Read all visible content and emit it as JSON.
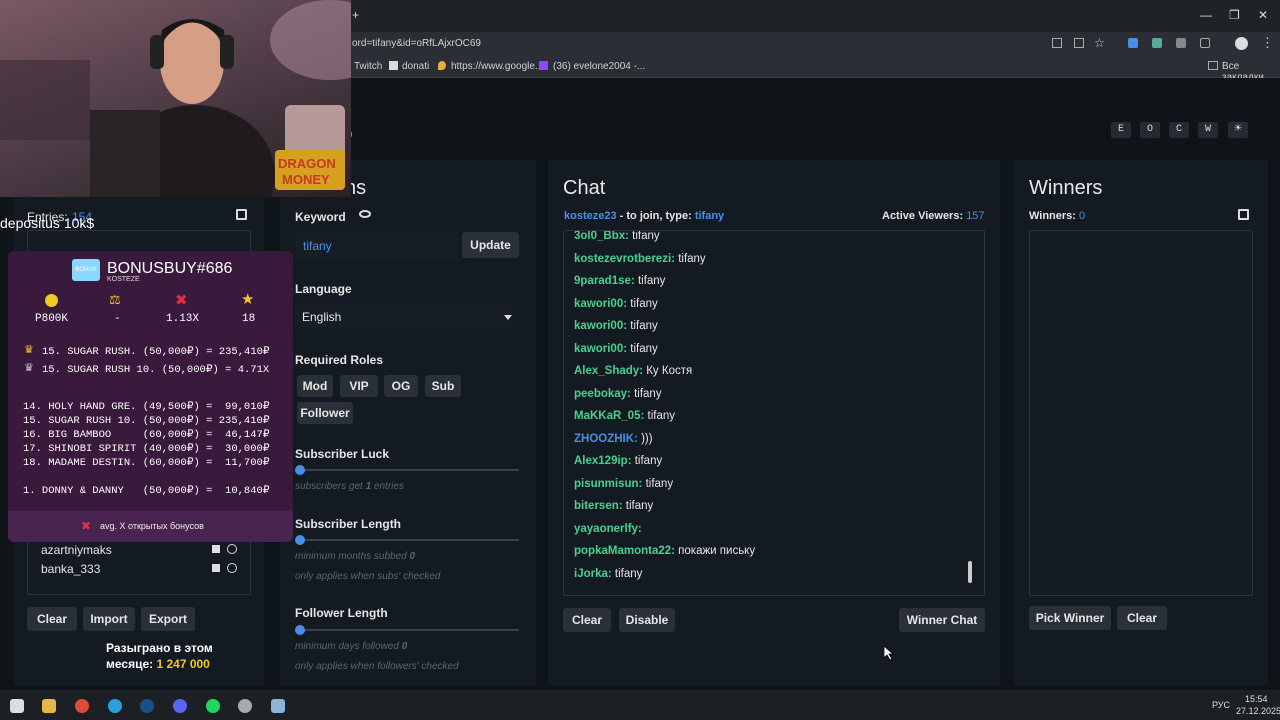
{
  "browser": {
    "url_fragment": "ord=tifany&id=oRfLAjxrOC69",
    "bookmarks": [
      "Twitch",
      "donati",
      "https://www.google...",
      "(36) evelone2004 -...",
      "Все закладки"
    ],
    "win_controls": [
      "—",
      "❐",
      "✕"
    ],
    "new_tab": "+"
  },
  "header": {
    "partial_title": "9",
    "theme_buttons": [
      "E",
      "O",
      "C",
      "W",
      "☀"
    ]
  },
  "overlay": {
    "deposit_text": "depositus 10k$",
    "footer_line1": "Разыграно в этом",
    "footer_line2_label": "месяце:",
    "footer_line2_value": "1 247 000",
    "bonus": {
      "title": "BONUSBUY#686",
      "subtitle": "KOSTEZE",
      "icon_label": "BONUS",
      "stats": [
        {
          "icon": "coin-icon",
          "value": "P800K"
        },
        {
          "icon": "scale-icon",
          "value": "-"
        },
        {
          "icon": "cross-icon",
          "value": "1.13X"
        },
        {
          "icon": "star-icon",
          "value": "18"
        }
      ],
      "top_lines": [
        "15. SUGAR RUSH. (50,000₽) = 235,410₽",
        "15. SUGAR RUSH 10. (50,000₽) = 4.71X"
      ],
      "list_lines": [
        "14. HOLY HAND GRE. (49,500₽) =  99,010₽",
        "15. SUGAR RUSH 10. (50,000₽) = 235,410₽",
        "16. BIG BAMBOO     (60,000₽) =  46,147₽",
        "17. SHINOBI SPIRIT (40,000₽) =  30,000₽",
        "18. MADAME DESTIN. (60,000₽) =  11,700₽"
      ],
      "bottom_line": "1. DONNY & DANNY   (50,000₽) =  10,840₽",
      "footer": "avg. X открытых бонусов"
    }
  },
  "entries": {
    "label": "Entries:",
    "count": "154",
    "users": [
      "azartniymaks",
      "banka_333"
    ],
    "buttons": [
      "Clear",
      "Import",
      "Export"
    ]
  },
  "options": {
    "partial_heading": "ns",
    "keyword_label": "Keyword",
    "keyword_value": "tifany",
    "update_btn": "Update",
    "language_label": "Language",
    "language_value": "English",
    "roles_label": "Required Roles",
    "roles": [
      "Mod",
      "VIP",
      "OG",
      "Sub",
      "Follower"
    ],
    "sub_luck_label": "Subscriber Luck",
    "sub_luck_hint_pre": "subscribers get",
    "sub_luck_hint_num": "1",
    "sub_luck_hint_post": "entries",
    "sub_length_label": "Subscriber Length",
    "sub_length_hint_pre": "minimum months subbed",
    "sub_length_hint_num": "0",
    "sub_length_hint2": "only applies when subs' checked",
    "follow_length_label": "Follower Length",
    "follow_length_hint_pre": "minimum days followed",
    "follow_length_hint_num": "0",
    "follow_length_hint2": "only applies when followers' checked"
  },
  "chat": {
    "heading": "Chat",
    "join_user": "kosteze23",
    "join_text": "- to join, type:",
    "join_keyword": "tifany",
    "viewers_label": "Active Viewers:",
    "viewers_count": "157",
    "messages": [
      {
        "user": "3ol0_Bbx:",
        "msg": "tifany",
        "c": "g"
      },
      {
        "user": "kostezevrotberezi:",
        "msg": "tifany",
        "c": "g"
      },
      {
        "user": "9parad1se:",
        "msg": "tifany",
        "c": "g"
      },
      {
        "user": "kawori00:",
        "msg": "tifany",
        "c": "g"
      },
      {
        "user": "kawori00:",
        "msg": "tifany",
        "c": "g"
      },
      {
        "user": "kawori00:",
        "msg": "tifany",
        "c": "g"
      },
      {
        "user": "Alex_Shady:",
        "msg": "Ку Костя",
        "c": "g"
      },
      {
        "user": "peebokay:",
        "msg": "tifany",
        "c": "g"
      },
      {
        "user": "MaKKaR_05:",
        "msg": "tifany",
        "c": "g"
      },
      {
        "user": "ZHOOZHIK:",
        "msg": ")))",
        "c": "b"
      },
      {
        "user": "Alex129ip:",
        "msg": "tifany",
        "c": "g"
      },
      {
        "user": "pisunmisun:",
        "msg": "tifany",
        "c": "g"
      },
      {
        "user": "bitersen:",
        "msg": "tifany",
        "c": "g"
      },
      {
        "user": "yayaonerlfy:",
        "msg": "",
        "c": "g"
      },
      {
        "user": "popkaMamonta22:",
        "msg": "покажи письку",
        "c": "g"
      },
      {
        "user": "iJorka:",
        "msg": "tifany",
        "c": "g"
      }
    ],
    "clear_btn": "Clear",
    "disable_btn": "Disable",
    "winner_chat_btn": "Winner Chat"
  },
  "winners": {
    "heading": "Winners",
    "label": "Winners:",
    "count": "0",
    "pick_btn": "Pick Winner",
    "clear_btn": "Clear"
  },
  "taskbar": {
    "lang": "РУС",
    "time": "15:54",
    "date": "27.12.2025"
  },
  "colors": {
    "accent": "#4a8fe7",
    "user_green": "#4bd08f",
    "panel_bg": "#141a21",
    "page_bg": "#0f1419"
  }
}
